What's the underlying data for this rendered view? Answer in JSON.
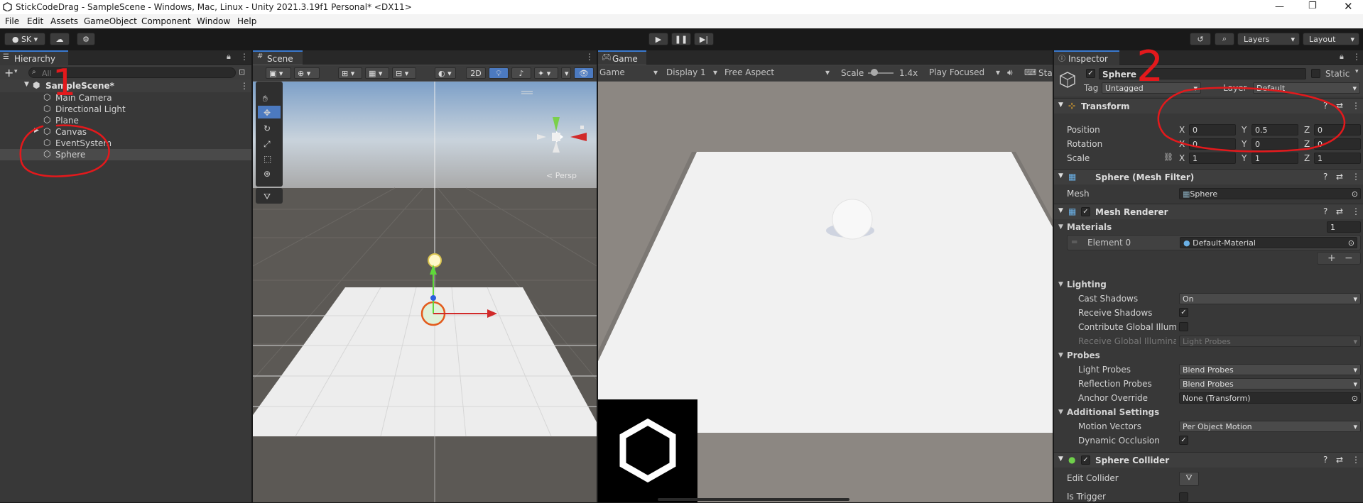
{
  "window": {
    "title": "StickCodeDrag - SampleScene - Windows, Mac, Linux - Unity 2021.3.19f1 Personal* <DX11>"
  },
  "menu": [
    "File",
    "Edit",
    "Assets",
    "GameObject",
    "Component",
    "Window",
    "Help"
  ],
  "toolbar": {
    "account": "SK",
    "layers": "Layers",
    "layout": "Layout"
  },
  "hierarchy": {
    "tab": "Hierarchy",
    "search_placeholder": "All",
    "scene": "SampleScene*",
    "items": [
      "Main Camera",
      "Directional Light",
      "Plane",
      "Canvas",
      "EventSystem",
      "Sphere"
    ]
  },
  "scene": {
    "tab": "Scene",
    "mode2d": "2D",
    "persp": "< Persp"
  },
  "game": {
    "tab": "Game",
    "view": "Game",
    "display": "Display 1",
    "aspect": "Free Aspect",
    "scale_label": "Scale",
    "scale_value": "1.4x",
    "play_mode": "Play Focused",
    "stats": "Sta"
  },
  "inspector": {
    "tab": "Inspector",
    "object_name": "Sphere",
    "static_label": "Static",
    "tag_label": "Tag",
    "tag_value": "Untagged",
    "layer_label": "Layer",
    "layer_value": "Default",
    "transform": {
      "title": "Transform",
      "position_label": "Position",
      "rotation_label": "Rotation",
      "scale_label": "Scale",
      "x": "X",
      "y": "Y",
      "z": "Z",
      "position": [
        "0",
        "0.5",
        "0"
      ],
      "rotation": [
        "0",
        "0",
        "0"
      ],
      "scale": [
        "1",
        "1",
        "1"
      ]
    },
    "mesh_filter": {
      "title": "Sphere (Mesh Filter)",
      "mesh_label": "Mesh",
      "mesh_value": "Sphere"
    },
    "mesh_renderer": {
      "title": "Mesh Renderer",
      "materials_label": "Materials",
      "materials_count": "1",
      "element_label": "Element 0",
      "element_value": "Default-Material",
      "add": "+",
      "remove": "−",
      "lighting": "Lighting",
      "cast_shadows_label": "Cast Shadows",
      "cast_shadows_value": "On",
      "receive_shadows_label": "Receive Shadows",
      "contribute_gi_label": "Contribute Global Illumina",
      "receive_gi_label": "Receive Global Illuminati",
      "receive_gi_value": "Light Probes",
      "probes": "Probes",
      "light_probes_label": "Light Probes",
      "light_probes_value": "Blend Probes",
      "reflection_probes_label": "Reflection Probes",
      "reflection_probes_value": "Blend Probes",
      "anchor_override_label": "Anchor Override",
      "anchor_override_value": "None (Transform)",
      "additional_settings": "Additional Settings",
      "motion_vectors_label": "Motion Vectors",
      "motion_vectors_value": "Per Object Motion",
      "dynamic_occlusion_label": "Dynamic Occlusion"
    },
    "sphere_collider": {
      "title": "Sphere Collider",
      "edit_collider_label": "Edit Collider",
      "is_trigger_label": "Is Trigger"
    }
  },
  "annotations": {
    "one": "1",
    "two": "2"
  },
  "colors": {
    "accent": "#3a7ad0",
    "annotation": "#e3191c",
    "panel": "#383838"
  }
}
